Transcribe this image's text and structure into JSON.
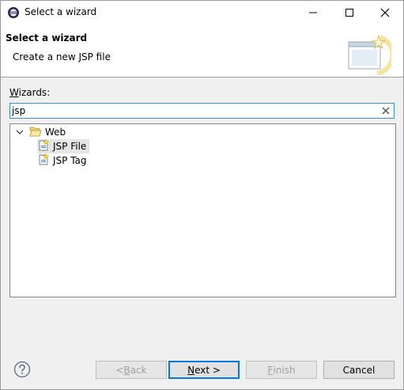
{
  "window": {
    "title": "Select a wizard"
  },
  "banner": {
    "title": "Select a wizard",
    "description": "Create a new JSP file"
  },
  "wizards": {
    "label_mnemonic": "W",
    "label_rest": "izards:",
    "filter_value": "jsp"
  },
  "tree": {
    "category": "Web",
    "items": [
      {
        "label": "JSP File",
        "selected": true
      },
      {
        "label": "JSP Tag",
        "selected": false
      }
    ]
  },
  "buttons": {
    "back_prefix": "< ",
    "back_mnemonic": "B",
    "back_rest": "ack",
    "next_mnemonic": "N",
    "next_rest": "ext >",
    "finish_mnemonic": "F",
    "finish_rest": "inish",
    "cancel": "Cancel"
  },
  "colors": {
    "focus_border": "#3c8ed2",
    "default_button_border": "#0078d7",
    "disabled_text": "#a0a0a0"
  }
}
